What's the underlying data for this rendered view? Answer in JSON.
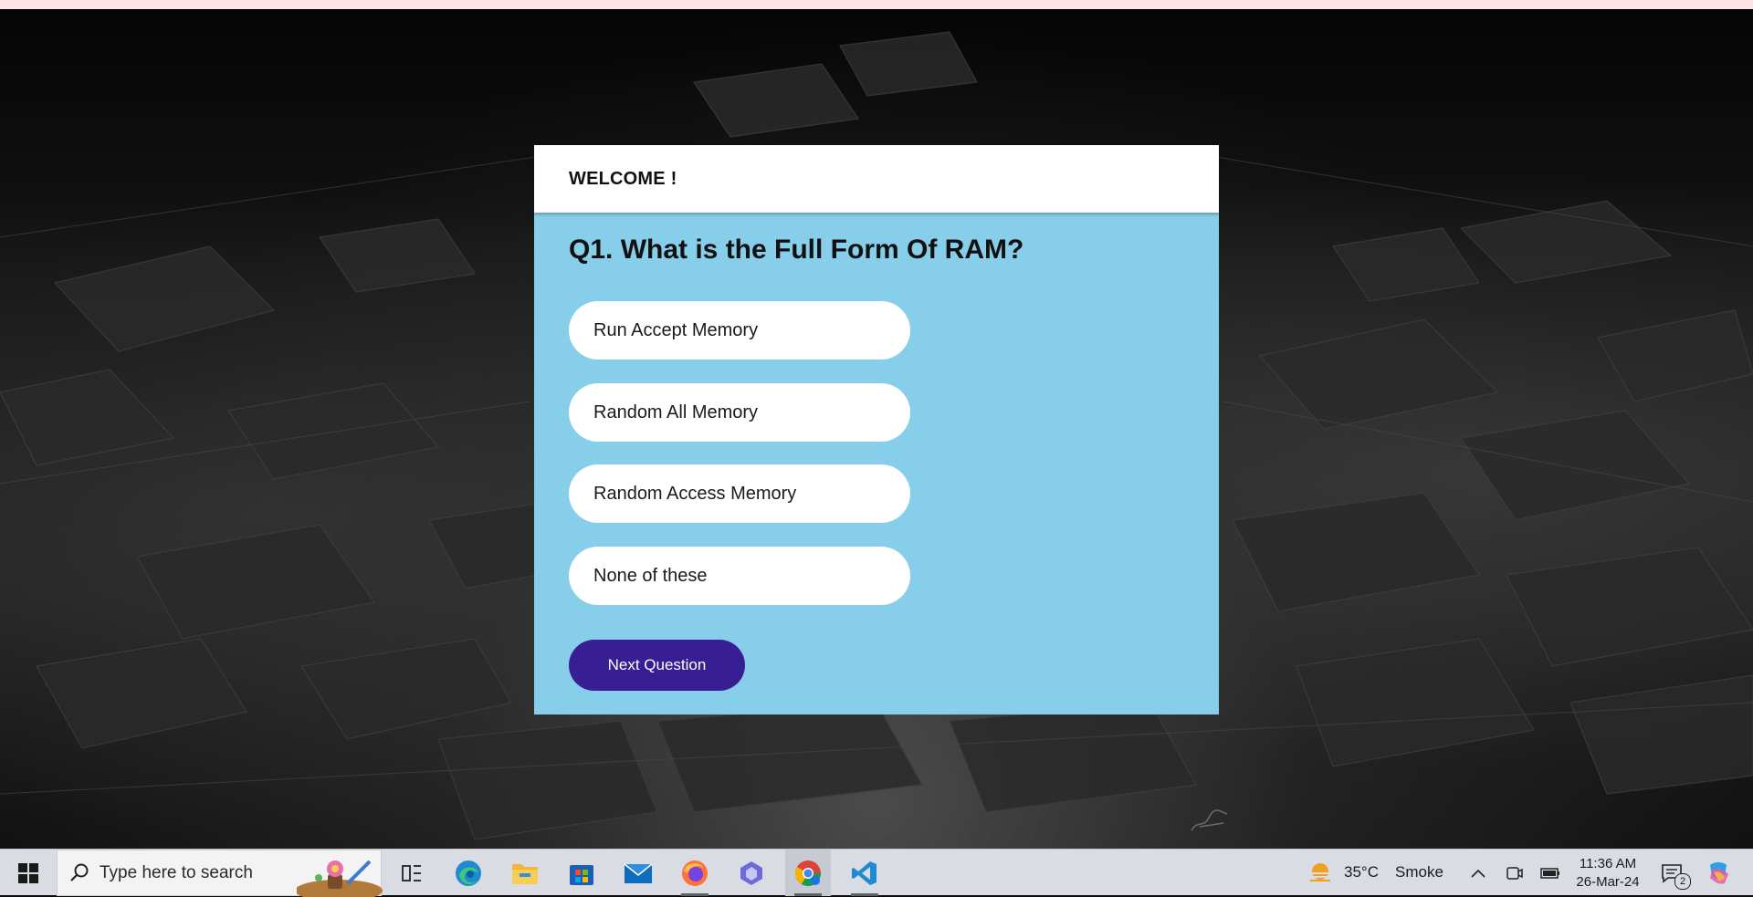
{
  "quiz": {
    "header": "WELCOME !",
    "question": "Q1. What is the Full Form Of RAM?",
    "options": [
      "Run Accept Memory",
      "Random All Memory",
      "Random Access Memory",
      "None of these"
    ],
    "next_label": "Next Question"
  },
  "colors": {
    "card_bg": "#87ceeb",
    "button_bg": "#381e94",
    "header_bg": "#ffffff"
  },
  "taskbar": {
    "search_placeholder": "Type here to search",
    "weather_temp": "35°C",
    "weather_label": "Smoke",
    "time": "11:36 AM",
    "date": "26-Mar-24",
    "notification_count": "2",
    "apps": [
      "task-view",
      "edge",
      "file-explorer",
      "microsoft-store",
      "mail",
      "firefox",
      "copilot-app",
      "chrome",
      "vscode"
    ]
  }
}
